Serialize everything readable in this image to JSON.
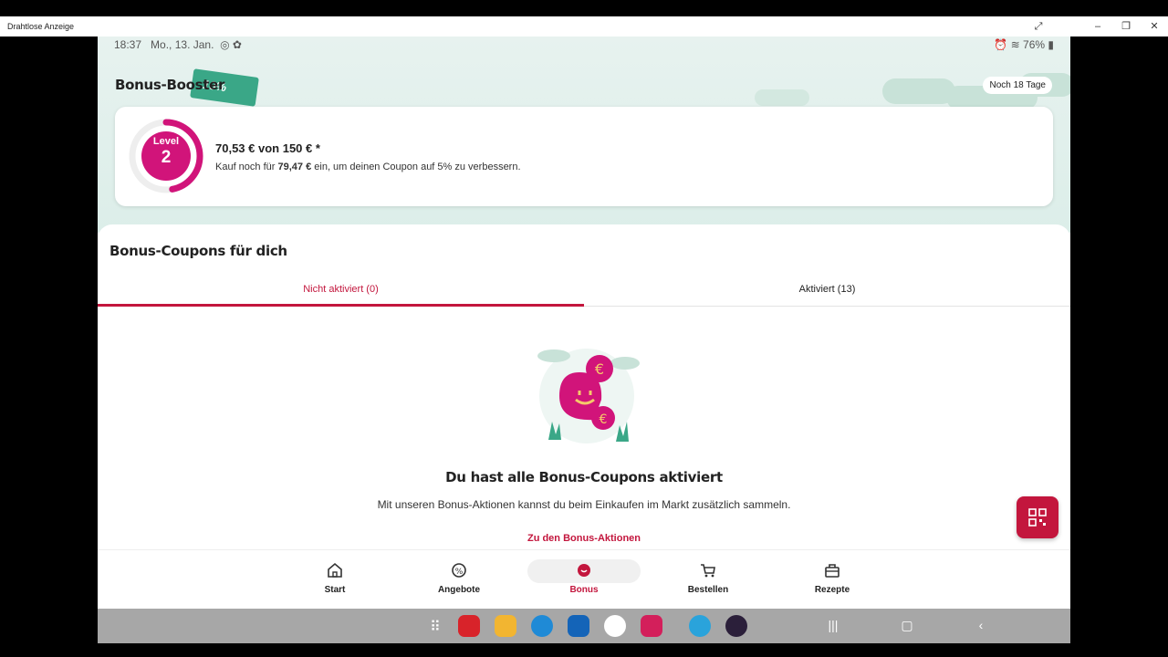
{
  "window": {
    "title": "Drahtlose Anzeige"
  },
  "statusbar": {
    "time": "18:37",
    "date": "Mo., 13. Jan.",
    "battery": "76%"
  },
  "booster": {
    "title": "Bonus-Booster",
    "ticket_percent": "10%",
    "days_left": "Noch 18 Tage",
    "level_label": "Level",
    "level_number": "2",
    "progress_fraction": 0.47,
    "amount": "70,53 € von 150 € *",
    "hint_prefix": "Kauf noch für",
    "hint_amount": "79,47 €",
    "hint_suffix": "ein, um deinen Coupon auf 5% zu verbessern."
  },
  "coupons": {
    "section_title": "Bonus-Coupons für dich",
    "tabs": [
      {
        "label": "Nicht aktiviert (0)"
      },
      {
        "label": "Aktiviert (13)"
      }
    ],
    "empty_title": "Du hast alle Bonus-Coupons aktiviert",
    "empty_text": "Mit unseren Bonus-Aktionen kannst du beim Einkaufen im Markt zusätzlich sammeln.",
    "empty_link": "Zu den Bonus-Aktionen"
  },
  "nav": {
    "items": [
      {
        "label": "Start",
        "icon": "home-icon"
      },
      {
        "label": "Angebote",
        "icon": "offers-icon"
      },
      {
        "label": "Bonus",
        "icon": "bonus-icon"
      },
      {
        "label": "Bestellen",
        "icon": "cart-icon"
      },
      {
        "label": "Rezepte",
        "icon": "recipes-icon"
      }
    ],
    "active": "Bonus"
  },
  "colors": {
    "accent": "#c3163d",
    "level": "#d1147a",
    "mint": "#dceee9",
    "taskbar": "#a7a7a7"
  }
}
